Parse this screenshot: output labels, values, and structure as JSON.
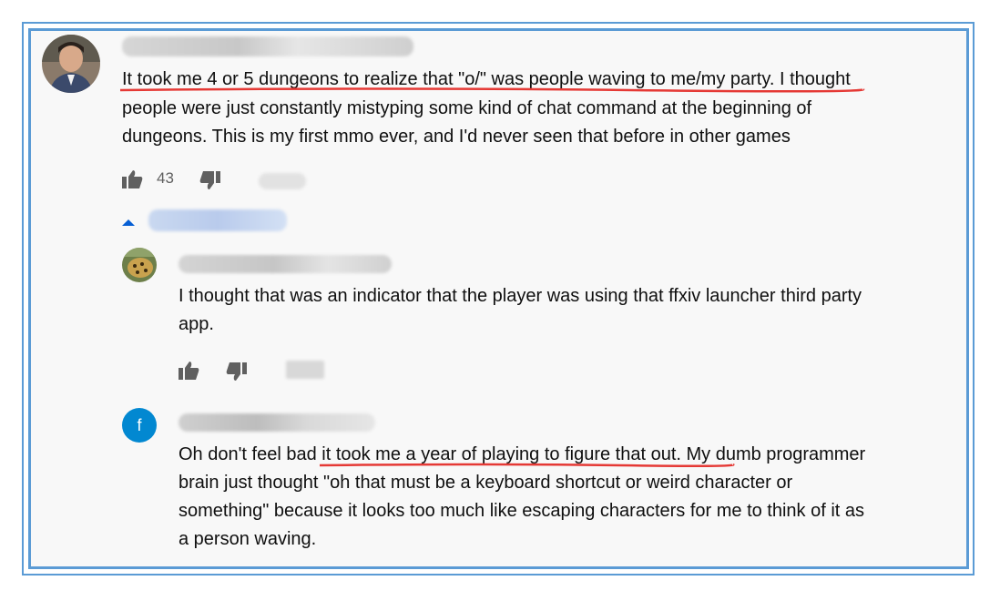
{
  "comments": [
    {
      "author_redacted": true,
      "avatar": "person-photo",
      "text_underlined": "It took me 4 or 5 dungeons to realize that \"o/\" was people waving to me/my party.",
      "line1_rest": " I thought",
      "line2": "people were just constantly mistyping some kind of chat command at the beginning of",
      "line3": "dungeons.  This is my first mmo ever, and I'd never seen that before in other games",
      "likes": "43",
      "actions": [
        "thumbs-up-icon",
        "thumbs-down-icon"
      ]
    },
    {
      "author_redacted": true,
      "avatar": "leopard-photo",
      "line1": "I thought that was an indicator that the player was using that ffxiv launcher third party",
      "line2": "app.",
      "actions": [
        "thumbs-up-icon",
        "thumbs-down-icon"
      ]
    },
    {
      "author_redacted": true,
      "avatar_letter": "f",
      "avatar_color": "#0288d1",
      "line1_pre": "Oh don't feel bad ",
      "line1_underlined": "it took me a year of playing to figure that out.",
      "line1_rest": " My dumb programmer",
      "line2": "brain just thought \"oh that must be a keyboard shortcut or weird character or",
      "line3": "something\" because it looks too much like escaping characters for me to think of it as",
      "line4": "a person waving."
    }
  ],
  "colors": {
    "frame": "#5b9bd5",
    "underline": "#e53935",
    "reply_toggle": "#065fd4"
  }
}
